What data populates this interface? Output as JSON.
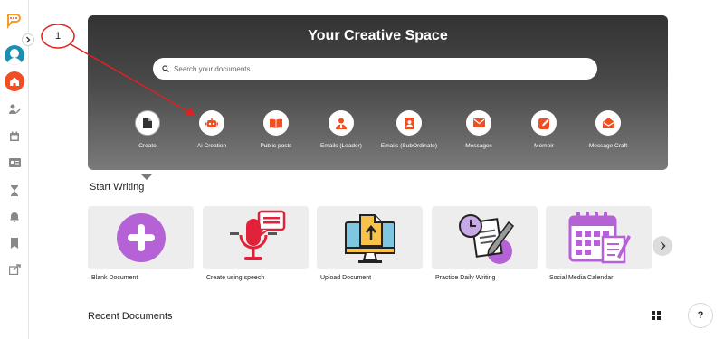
{
  "sidebar": {
    "items": [
      {
        "name": "people-edit-icon"
      },
      {
        "name": "calendar-icon"
      },
      {
        "name": "id-card-icon"
      },
      {
        "name": "hourglass-icon"
      },
      {
        "name": "bell-icon"
      },
      {
        "name": "bookmark-icon"
      },
      {
        "name": "share-icon"
      }
    ]
  },
  "hero": {
    "title": "Your Creative Space",
    "search_placeholder": "Search your documents",
    "categories": [
      {
        "label": "Create",
        "icon": "document-icon",
        "active": true
      },
      {
        "label": "Ai Creation",
        "icon": "robot-icon",
        "active": false
      },
      {
        "label": "Public posts",
        "icon": "book-open-icon",
        "active": false
      },
      {
        "label": "Emails (Leader)",
        "icon": "leader-icon",
        "active": false
      },
      {
        "label": "Emails (SubOrdinate)",
        "icon": "contact-card-icon",
        "active": false
      },
      {
        "label": "Messages",
        "icon": "envelope-icon",
        "active": false
      },
      {
        "label": "Memoir",
        "icon": "pen-square-icon",
        "active": false
      },
      {
        "label": "Message Craft",
        "icon": "envelope-open-icon",
        "active": false
      }
    ]
  },
  "start_writing": {
    "title": "Start Writing",
    "cards": [
      {
        "label": "Blank Document",
        "icon": "plus-circle-icon"
      },
      {
        "label": "Create using speech",
        "icon": "microphone-chat-icon"
      },
      {
        "label": "Upload Document",
        "icon": "upload-monitor-icon"
      },
      {
        "label": "Practice Daily Writing",
        "icon": "clock-notepad-icon"
      },
      {
        "label": "Social Media Calendar",
        "icon": "calendar-edit-icon"
      }
    ]
  },
  "recent_documents": {
    "title": "Recent Documents"
  },
  "help": {
    "label": "?"
  },
  "annotation": {
    "number": "1"
  },
  "colors": {
    "accent": "#f04e23",
    "purple": "#b462d6",
    "hero_top": "#333333",
    "hero_bottom": "#7a7a7a"
  }
}
